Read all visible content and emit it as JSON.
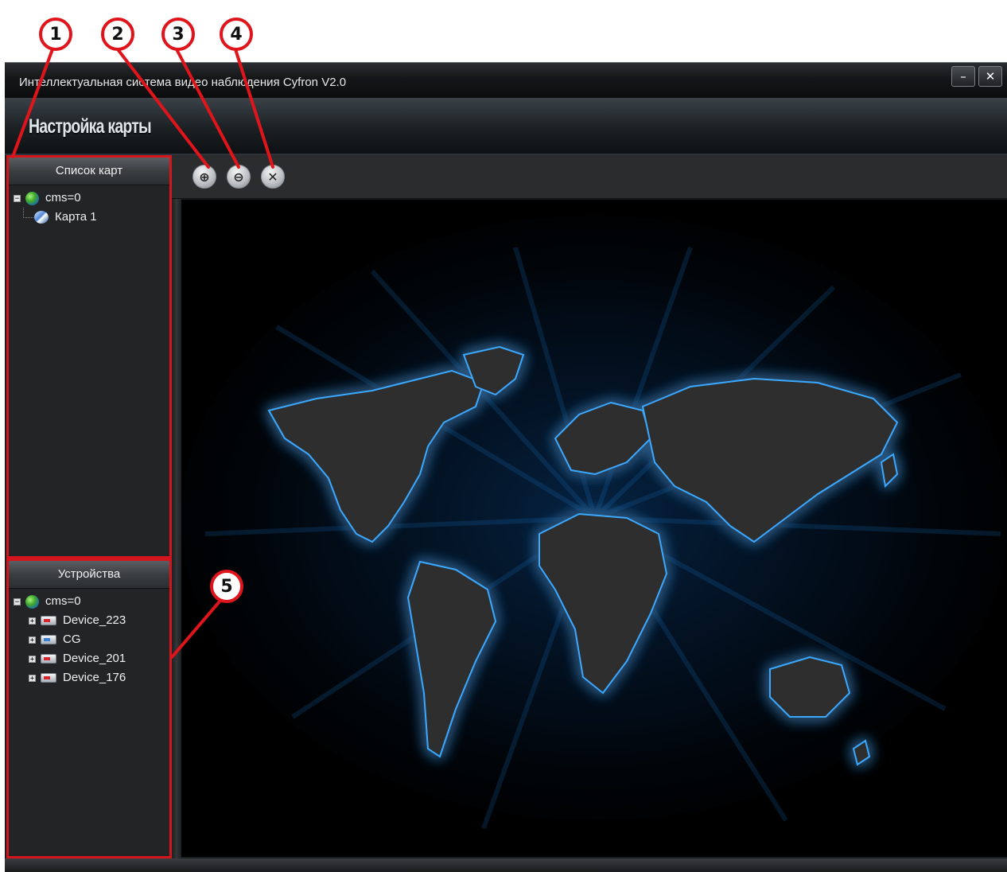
{
  "window": {
    "title": "Интеллектуальная система видео наблюдения Cyfron V2.0",
    "minimize_label": "–",
    "close_label": "✕"
  },
  "header": {
    "title": "Настройка карты"
  },
  "maps_panel": {
    "title": "Список карт",
    "root": "cms=0",
    "root_expander": "−",
    "items": [
      {
        "label": "Карта 1",
        "icon": "map-icon"
      }
    ]
  },
  "devices_panel": {
    "title": "Устройства",
    "root": "cms=0",
    "root_expander": "−",
    "items": [
      {
        "label": "Device_223",
        "status": "offline",
        "expander": "+"
      },
      {
        "label": "CG",
        "status": "online",
        "expander": "+"
      },
      {
        "label": "Device_201",
        "status": "offline",
        "expander": "+"
      },
      {
        "label": "Device_176",
        "status": "offline",
        "expander": "+"
      }
    ]
  },
  "toolbar": {
    "zoom_in": "⊕",
    "zoom_out": "⊖",
    "delete": "✕"
  },
  "callouts": [
    "1",
    "2",
    "3",
    "4",
    "5"
  ],
  "colors": {
    "callout": "#e0141b",
    "map_glow": "#1e9bff",
    "continents": "#2f2f2f"
  }
}
